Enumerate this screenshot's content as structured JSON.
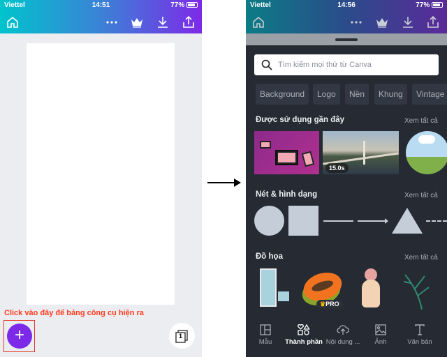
{
  "left_phone": {
    "status": {
      "carrier": "Viettel",
      "time": "14:51",
      "battery": "77%"
    },
    "header_icons": [
      "home-icon",
      "more-icon",
      "crown-icon",
      "download-icon",
      "share-icon"
    ],
    "annotation": "Click vào đây để bảng công cụ hiện ra",
    "add_button": "+",
    "page_count": "1",
    "colors": {
      "accent": "#7d2ae8",
      "annotation": "#ff3b1f"
    }
  },
  "right_phone": {
    "status": {
      "carrier": "Viettel",
      "time": "14:56",
      "battery": "77%"
    },
    "search": {
      "placeholder": "Tìm kiếm mọi thứ từ Canva"
    },
    "chips": [
      "Background",
      "Logo",
      "Nền",
      "Khung",
      "Vintage"
    ],
    "sections": [
      {
        "title": "Được sử dụng gần đây",
        "see_all": "Xem tất cả",
        "video_duration": "15.0s"
      },
      {
        "title": "Nét & hình dạng",
        "see_all": "Xem tất cả"
      },
      {
        "title": "Đồ họa",
        "see_all": "Xem tất cả",
        "pro_badge": "PRO"
      }
    ],
    "nav": [
      {
        "label": "Mẫu",
        "icon": "template-icon"
      },
      {
        "label": "Thành phần",
        "icon": "elements-icon",
        "active": true
      },
      {
        "label": "Nội dung ...",
        "icon": "upload-icon"
      },
      {
        "label": "Ảnh",
        "icon": "photo-icon"
      },
      {
        "label": "Văn bản",
        "icon": "text-icon"
      }
    ],
    "colors": {
      "panel": "#252a33",
      "shape": "#c5ced8"
    }
  }
}
